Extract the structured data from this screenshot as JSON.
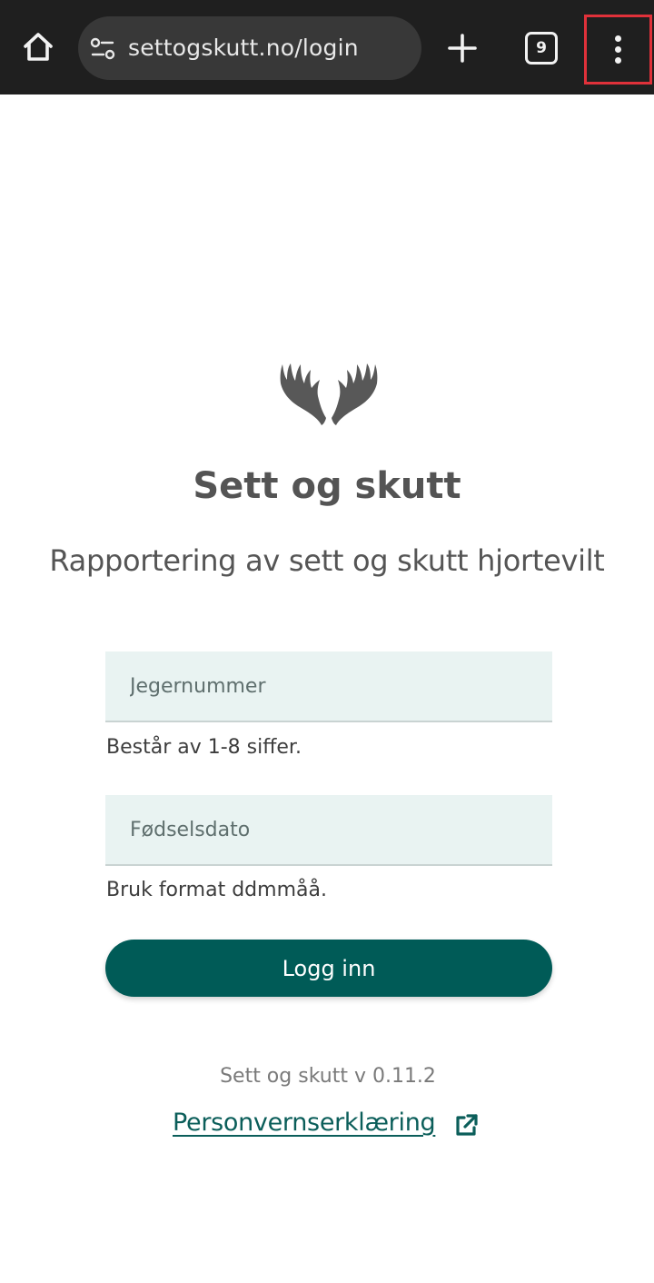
{
  "browser": {
    "url": "settogskutt.no/login",
    "tab_count": "9",
    "icons": {
      "home": "home-icon",
      "site_settings": "site-settings-icon",
      "new_tab": "plus-icon",
      "tabs": "tab-switcher-icon",
      "menu": "more-vert-icon"
    }
  },
  "app": {
    "title": "Sett og skutt",
    "subtitle": "Rapportering av sett og skutt hjortevilt",
    "logo_icon": "antlers-icon"
  },
  "form": {
    "hunter_number": {
      "placeholder": "Jegernummer",
      "value": "",
      "helper": "Består av 1-8 siffer."
    },
    "birth_date": {
      "placeholder": "Fødselsdato",
      "value": "",
      "helper": "Bruk format ddmmåå."
    },
    "login_label": "Logg inn"
  },
  "footer": {
    "version": "Sett og skutt v 0.11.2",
    "privacy_link": "Personvernserklæring",
    "privacy_icon": "external-link-icon"
  },
  "colors": {
    "brand": "#005b57",
    "input_bg": "#e9f3f2",
    "toolbar": "#1f1f1f",
    "highlight": "#e0313a"
  }
}
